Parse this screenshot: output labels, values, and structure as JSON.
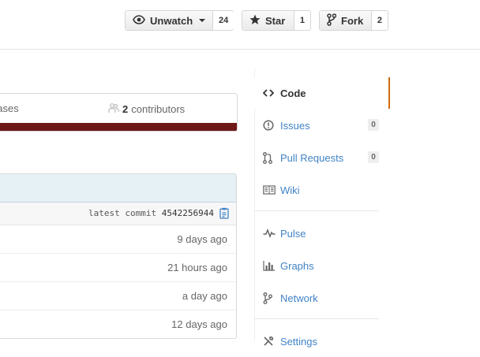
{
  "header": {
    "watch": {
      "label": "Unwatch",
      "count": "24"
    },
    "star": {
      "label": "Star",
      "count": "1"
    },
    "fork": {
      "label": "Fork",
      "count": "2"
    }
  },
  "summary": {
    "releases_partial": "eases",
    "contributors_count": "2",
    "contributors_label": "contributors",
    "bar_color": "#6e1818"
  },
  "files": {
    "commit_label": "latest commit",
    "commit_sha": "4542256944",
    "rows": [
      {
        "age": "9 days ago"
      },
      {
        "age": "21 hours ago"
      },
      {
        "age": "a day ago"
      },
      {
        "age": "12 days ago"
      }
    ]
  },
  "nav": {
    "code": "Code",
    "issues": {
      "label": "Issues",
      "count": "0"
    },
    "pull_requests": {
      "label": "Pull Requests",
      "count": "0"
    },
    "wiki": "Wiki",
    "pulse": "Pulse",
    "graphs": "Graphs",
    "network": "Network",
    "settings": "Settings"
  },
  "colors": {
    "link": "#4183c4",
    "active_accent": "#d26911"
  }
}
